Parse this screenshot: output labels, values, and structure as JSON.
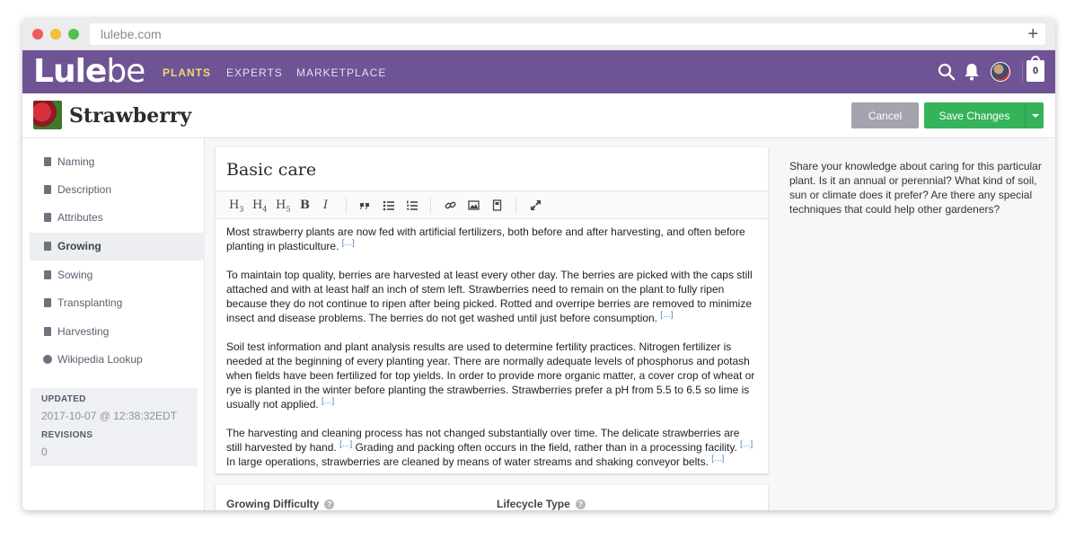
{
  "browser": {
    "url": "lulebe.com"
  },
  "brand": {
    "logo_bold": "Lule",
    "logo_light": "be"
  },
  "nav": {
    "items": [
      "PLANTS",
      "EXPERTS",
      "MARKETPLACE"
    ],
    "cart_count": "0"
  },
  "page": {
    "title": "Strawberry",
    "cancel_label": "Cancel",
    "save_label": "Save Changes"
  },
  "sidebar": {
    "items": [
      {
        "label": "Naming",
        "icon": "document-icon"
      },
      {
        "label": "Description",
        "icon": "document-icon"
      },
      {
        "label": "Attributes",
        "icon": "document-icon"
      },
      {
        "label": "Growing",
        "icon": "document-icon",
        "active": true
      },
      {
        "label": "Sowing",
        "icon": "document-icon"
      },
      {
        "label": "Transplanting",
        "icon": "document-icon"
      },
      {
        "label": "Harvesting",
        "icon": "document-icon"
      },
      {
        "label": "Wikipedia Lookup",
        "icon": "globe-icon"
      }
    ],
    "meta": {
      "updated_label": "UPDATED",
      "updated_value": "2017-10-07 @ 12:38:32EDT",
      "revisions_label": "REVISIONS",
      "revisions_value": "0"
    }
  },
  "editor": {
    "title": "Basic care",
    "toolbar": [
      "H3",
      "H4",
      "H5",
      "B",
      "I",
      "quote",
      "bullet-list",
      "numbered-list",
      "link",
      "image",
      "embed",
      "fullscreen"
    ],
    "ref_mark": "[…]",
    "paragraphs": [
      [
        "Most strawberry plants are now fed with artificial fertilizers, both before and after harvesting, and often before planting in plasticulture."
      ],
      [
        "To maintain top quality, berries are harvested at least every other day. The berries are picked with the caps still attached and with at least half an inch of stem left. Strawberries need to remain on the plant to fully ripen because they do not continue to ripen after being picked. Rotted and overripe berries are removed to minimize insect and disease problems. The berries do not get washed until just before consumption."
      ],
      [
        "Soil test information and plant analysis results are used to determine fertility practices. Nitrogen fertilizer is needed at the beginning of every planting year. There are normally adequate levels of phosphorus and potash when fields have been fertilized for top yields. In order to provide more organic matter, a cover crop of wheat or rye is planted in the winter before planting the strawberries. Strawberries prefer a pH from 5.5 to 6.5 so lime is usually not applied."
      ],
      [
        "The harvesting and cleaning process has not changed substantially over time. The delicate strawberries are still harvested by hand.",
        " Grading and packing often occurs in the field, rather than in a processing facility.",
        " In large operations, strawberries are cleaned by means of water streams and shaking conveyor belts."
      ]
    ]
  },
  "fields": {
    "growing_difficulty": "Growing Difficulty",
    "lifecycle_type": "Lifecycle Type",
    "help_mark": "?"
  },
  "help": {
    "text": "Share your knowledge about caring for this particular plant. Is it an annual or perennial? What kind of soil, sun or climate does it prefer? Are there any special techniques that could help other gardeners?"
  }
}
